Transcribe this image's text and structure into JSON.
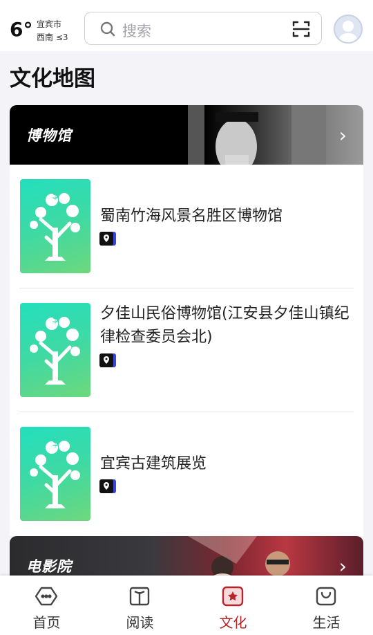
{
  "header": {
    "temperature": "6°",
    "city": "宜宾市",
    "wind": "西南 ≤3",
    "search_placeholder": "搜索",
    "icons": {
      "search": "search-icon",
      "scan": "scan-icon",
      "avatar": "avatar"
    }
  },
  "page": {
    "title": "文化地图"
  },
  "sections": {
    "museum": {
      "title": "博物馆"
    },
    "cinema": {
      "title": "电影院"
    }
  },
  "items": [
    {
      "name": "蜀南竹海风景名胜区博物馆",
      "icon": "map-pin-icon"
    },
    {
      "name": "夕佳山民俗博物馆(江安县夕佳山镇纪律检查委员会北)",
      "icon": "map-pin-icon"
    },
    {
      "name": "宜宾古建筑展览",
      "icon": "map-pin-icon"
    }
  ],
  "tabbar": {
    "tabs": [
      {
        "label": "首页",
        "icon": "home-icon"
      },
      {
        "label": "阅读",
        "icon": "book-icon"
      },
      {
        "label": "文化",
        "icon": "culture-icon",
        "active": true
      },
      {
        "label": "生活",
        "icon": "shopping-bag-icon"
      }
    ]
  },
  "colors": {
    "accent": "#b2262c",
    "thumb_gradient_start": "#23dfbe",
    "thumb_gradient_end": "#6ed87d",
    "background": "#f4f4f8"
  }
}
